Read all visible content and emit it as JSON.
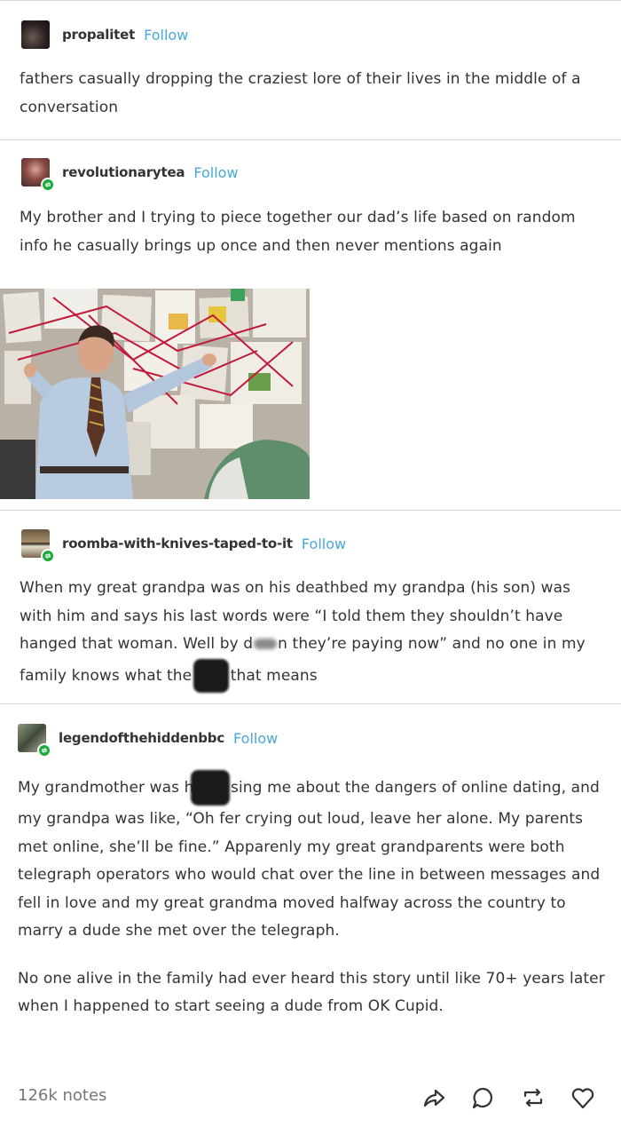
{
  "posts": [
    {
      "username": "propalitet",
      "follow_label": "Follow",
      "text": "fathers casually dropping the craziest lore of their lives in the middle of a conversation"
    },
    {
      "username": "revolutionarytea",
      "follow_label": "Follow",
      "text": "My brother and I trying to piece together our dad’s life based on random info he casually brings up once and then never mentions again",
      "image_description_tag": "conspiracy-board-photo"
    },
    {
      "username": "roomba-with-knives-taped-to-it",
      "follow_label": "Follow",
      "text_part1": "When my great grandpa was on his deathbed my grandpa (his son) was with him and says his last words were “I told them they shouldn’t have hanged that woman. Well by d",
      "text_part2": "n they’re paying now” and no one in my family knows what the ",
      "text_part3": "that means"
    },
    {
      "username": "legendofthehiddenbbc",
      "follow_label": "Follow",
      "text_part1": "My grandmother was ha",
      "text_part2": "sing me about the dangers of online dating, and my grandpa was like, “Oh fer crying out loud, leave her alone. My parents met online, she’ll be fine.” Apparenly my great grandparents were both telegraph operators who would chat over the line in between messages and fell in love and my great grandma moved halfway across the country to marry a dude she met over the telegraph.",
      "text_para2": "No one alive in the family had ever heard this story until like 70+ years later when I happened to start seeing a dude from OK Cupid."
    }
  ],
  "footer": {
    "notes": "126k notes",
    "icons": [
      "share-icon",
      "reply-icon",
      "reblog-icon",
      "like-icon"
    ]
  },
  "colors": {
    "follow": "#4aa8d8",
    "reblog_badge": "#1aaa3a",
    "divider": "#d6d6d6"
  }
}
